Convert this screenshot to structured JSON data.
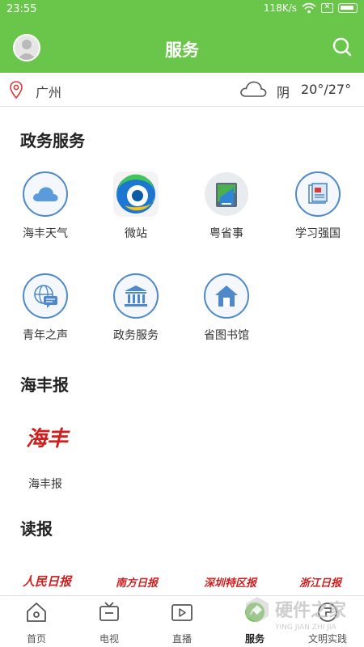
{
  "status_bar": {
    "time": "23:55",
    "speed": "118K/s"
  },
  "header": {
    "title": "服务"
  },
  "location": {
    "city": "广州",
    "weather": "阴",
    "temperature": "20°/27°"
  },
  "sections": {
    "gov": {
      "title": "政务服务",
      "items": [
        {
          "label": "海丰天气",
          "icon": "cloud-icon"
        },
        {
          "label": "微站",
          "icon": "weizhan-icon"
        },
        {
          "label": "粤省事",
          "icon": "yueshengshi-icon"
        },
        {
          "label": "学习强国",
          "icon": "xuexi-icon"
        },
        {
          "label": "青年之声",
          "icon": "globe-chat-icon"
        },
        {
          "label": "政务服务",
          "icon": "building-icon"
        },
        {
          "label": "省图书馆",
          "icon": "house-icon"
        }
      ]
    },
    "haifeng": {
      "title": "海丰报",
      "items": [
        {
          "label": "海丰报",
          "logo": "海丰"
        }
      ]
    },
    "read": {
      "title": "读报",
      "papers": [
        "人民日报",
        "南方日报",
        "深圳特区报",
        "浙江日报"
      ]
    }
  },
  "bottom_nav": [
    {
      "label": "首页",
      "icon": "home-icon"
    },
    {
      "label": "电视",
      "icon": "tv-icon"
    },
    {
      "label": "直播",
      "icon": "live-icon"
    },
    {
      "label": "服务",
      "icon": "service-icon",
      "active": true
    },
    {
      "label": "文明实践",
      "icon": "practice-icon"
    }
  ],
  "watermark": {
    "text": "硬件之家",
    "subtext": "YING JIAN ZHI JIA"
  },
  "colors": {
    "brand_green": "#6ac64a",
    "icon_blue": "#4f89c9",
    "paper_red": "#d01e1e"
  }
}
